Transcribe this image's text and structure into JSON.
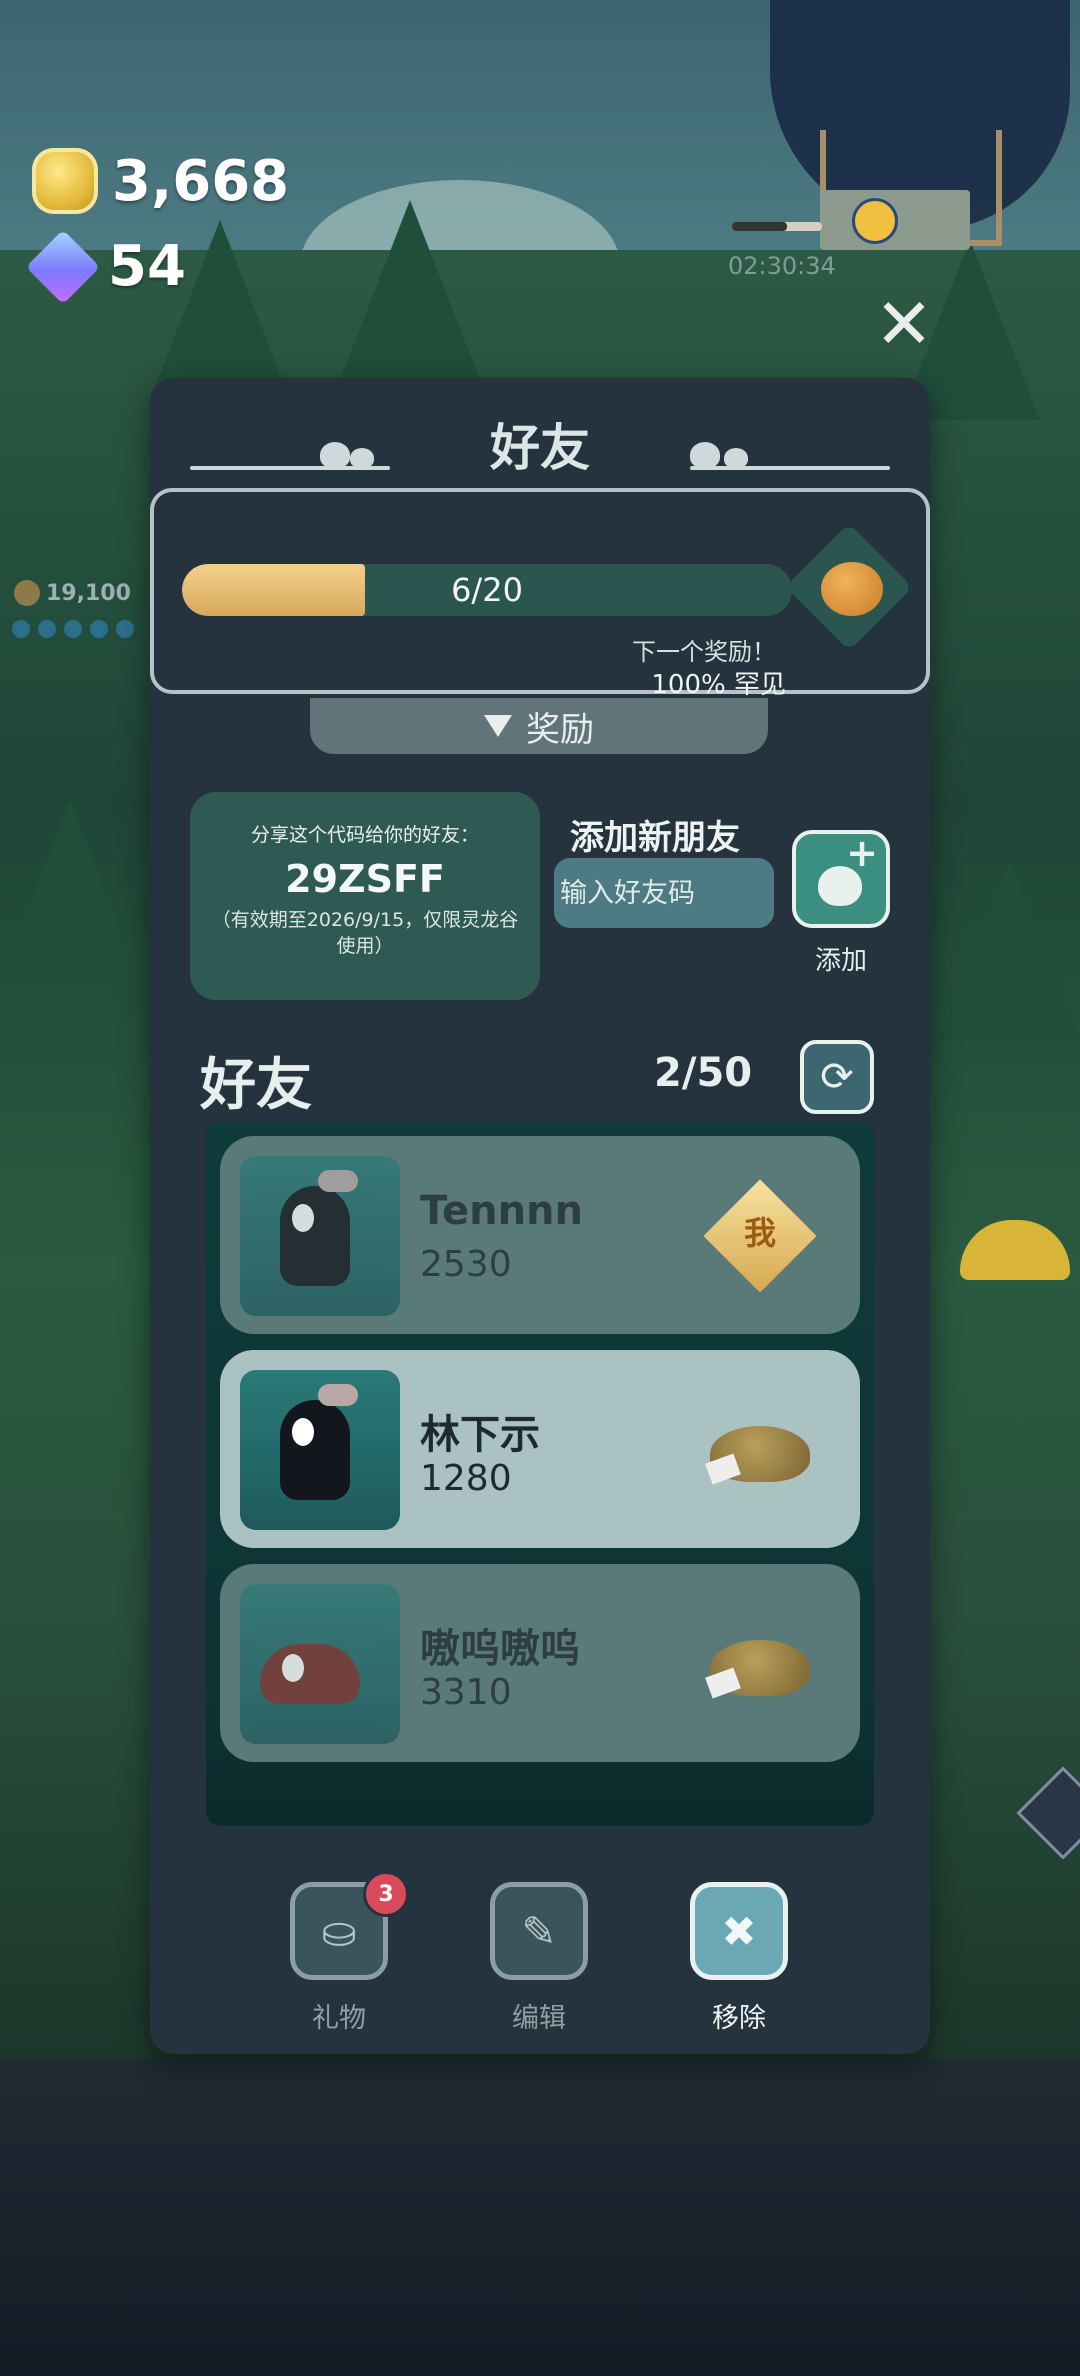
{
  "hud": {
    "gold": "3,668",
    "gems": "54",
    "timer": "02:30:34",
    "side_coins": "19,100"
  },
  "panel": {
    "title": "好友",
    "progress": {
      "current": 6,
      "max": 20,
      "text": "6/20",
      "fraction": 0.3
    },
    "next_reward_label": "下一个奖励！",
    "reward_rarity": "100% 罕见",
    "rewards_tab_label": "奖励"
  },
  "share": {
    "label": "分享这个代码给你的好友：",
    "code": "29ZSFF",
    "note": "（有效期至2026/9/15，仅限灵龙谷使用）"
  },
  "add_friend": {
    "title": "添加新朋友",
    "placeholder": "输入好友码",
    "button_label": "添加"
  },
  "friends": {
    "title": "好友",
    "count": "2/50",
    "list": [
      {
        "name": "Tennnn",
        "score": "2530",
        "badge": "我"
      },
      {
        "name": "林下示",
        "score": "1280"
      },
      {
        "name": "嗷呜嗷呜",
        "score": "3310"
      }
    ]
  },
  "bottom_bar": {
    "gift_label": "礼物",
    "gift_badge": "3",
    "edit_label": "编辑",
    "remove_label": "移除"
  },
  "colors": {
    "panel": "#24333d",
    "progress_fill": "#e5be78",
    "accent": "#3a8f80",
    "row_highlight": "#aac3c2"
  }
}
